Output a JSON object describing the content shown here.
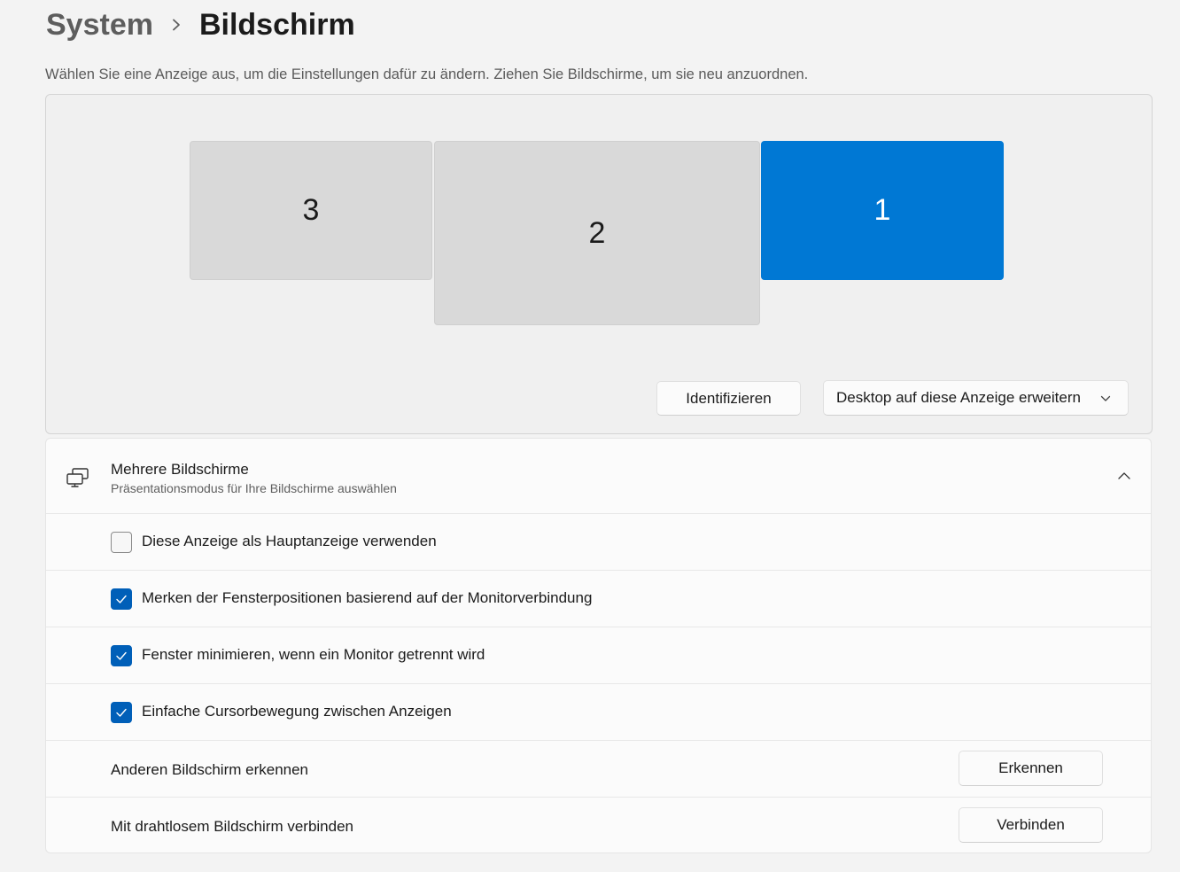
{
  "breadcrumb": {
    "parent": "System",
    "current": "Bildschirm"
  },
  "instructions": "Wählen Sie eine Anzeige aus, um die Einstellungen dafür zu ändern. Ziehen Sie Bildschirme, um sie neu anzuordnen.",
  "monitors": [
    {
      "label": "3",
      "selected": false
    },
    {
      "label": "2",
      "selected": false
    },
    {
      "label": "1",
      "selected": true
    }
  ],
  "arrangement": {
    "identify_label": "Identifizieren",
    "mode_dropdown": "Desktop auf diese Anzeige erweitern"
  },
  "multiple_displays": {
    "title": "Mehrere Bildschirme",
    "subtitle": "Präsentationsmodus für Ihre Bildschirme auswählen",
    "expanded": true,
    "options": [
      {
        "label": "Diese Anzeige als Hauptanzeige verwenden",
        "checked": false
      },
      {
        "label": "Merken der Fensterpositionen basierend auf der Monitorverbindung",
        "checked": true
      },
      {
        "label": "Fenster minimieren, wenn ein Monitor getrennt wird",
        "checked": true
      },
      {
        "label": "Einfache Cursorbewegung zwischen Anzeigen",
        "checked": true
      }
    ],
    "detect": {
      "label": "Anderen Bildschirm erkennen",
      "button": "Erkennen"
    },
    "wireless": {
      "label": "Mit drahtlosem Bildschirm verbinden",
      "button": "Verbinden"
    }
  },
  "colors": {
    "accent": "#0078d4",
    "checkbox_checked": "#005fb8",
    "page_background": "#f3f3f3"
  },
  "icons": {
    "breadcrumb_separator": "chevron-right-icon",
    "dropdown": "chevron-down-icon",
    "card": "multiple-monitors-icon",
    "collapse": "chevron-up-icon",
    "checkmark": "checkmark-icon"
  }
}
